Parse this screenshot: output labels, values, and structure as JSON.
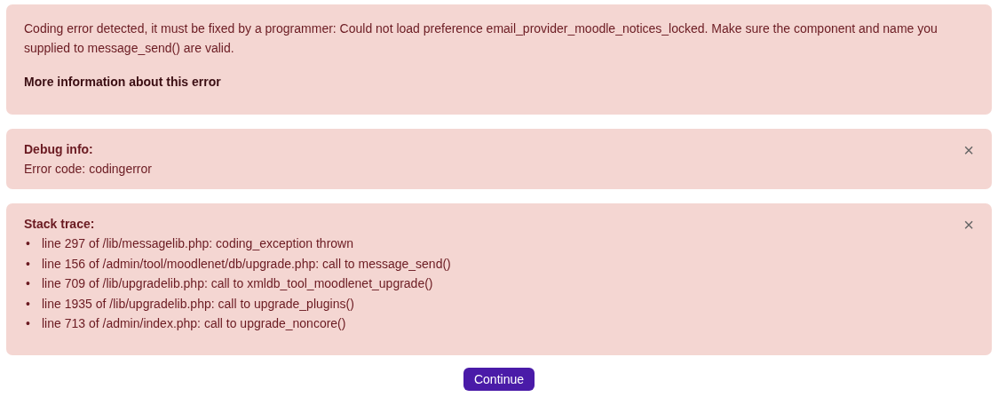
{
  "error_notice": {
    "message": "Coding error detected, it must be fixed by a programmer: Could not load preference email_provider_moodle_notices_locked. Make sure the component and name you supplied to message_send() are valid.",
    "more_info_link": "More information about this error"
  },
  "debug_info": {
    "title": "Debug info:",
    "text": "Error code: codingerror",
    "close": "×"
  },
  "stack_trace": {
    "title": "Stack trace:",
    "close": "×",
    "lines": [
      {
        "bullet": "•",
        "text": "line 297 of /lib/messagelib.php: coding_exception thrown"
      },
      {
        "bullet": "•",
        "text": "line 156 of /admin/tool/moodlenet/db/upgrade.php: call to message_send()"
      },
      {
        "bullet": "•",
        "text": "line 709 of /lib/upgradelib.php: call to xmldb_tool_moodlenet_upgrade()"
      },
      {
        "bullet": "•",
        "text": "line 1935 of /lib/upgradelib.php: call to upgrade_plugins()"
      },
      {
        "bullet": "•",
        "text": "line 713 of /admin/index.php: call to upgrade_noncore()"
      }
    ]
  },
  "continue_button": "Continue"
}
